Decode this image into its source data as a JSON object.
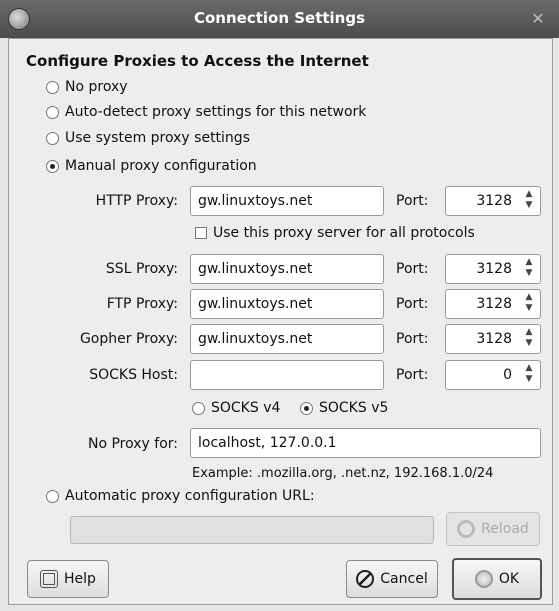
{
  "window": {
    "title": "Connection Settings",
    "close_glyph": "✕"
  },
  "heading": "Configure Proxies to Access the Internet",
  "options": {
    "no_proxy": "No proxy",
    "auto_detect": "Auto-detect proxy settings for this network",
    "system": "Use system proxy settings",
    "manual": "Manual proxy configuration",
    "auto_url": "Automatic proxy configuration URL:"
  },
  "selected_option": "manual",
  "http": {
    "label": "HTTP Proxy:",
    "host": "gw.linuxtoys.net",
    "port_label": "Port:",
    "port": "3128"
  },
  "same_proxy_label": "Use this proxy server for all protocols",
  "ssl": {
    "label": "SSL Proxy:",
    "host": "gw.linuxtoys.net",
    "port_label": "Port:",
    "port": "3128"
  },
  "ftp": {
    "label": "FTP Proxy:",
    "host": "gw.linuxtoys.net",
    "port_label": "Port:",
    "port": "3128"
  },
  "gopher": {
    "label": "Gopher Proxy:",
    "host": "gw.linuxtoys.net",
    "port_label": "Port:",
    "port": "3128"
  },
  "socks": {
    "label": "SOCKS Host:",
    "host": "",
    "port_label": "Port:",
    "port": "0",
    "v4": "SOCKS v4",
    "v5": "SOCKS v5",
    "selected_version": "v5"
  },
  "no_proxy_for": {
    "label": "No Proxy for:",
    "value": "localhost, 127.0.0.1",
    "example": "Example: .mozilla.org, .net.nz, 192.168.1.0/24"
  },
  "auto_url_value": "",
  "buttons": {
    "reload": "Reload",
    "help": "Help",
    "cancel": "Cancel",
    "ok": "OK"
  }
}
